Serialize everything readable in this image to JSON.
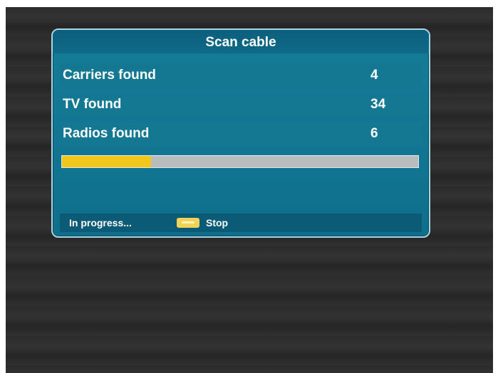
{
  "dialog": {
    "title": "Scan cable",
    "rows": [
      {
        "label": "Carriers found",
        "value": "4"
      },
      {
        "label": "TV found",
        "value": "34"
      },
      {
        "label": "Radios found",
        "value": "6"
      }
    ],
    "progress": {
      "fraction": 0.25,
      "fill_color": "#f0c71a",
      "track_color": "#b9bcbc"
    },
    "footer": {
      "status": "In progress...",
      "stop_key_icon": "yellow-key-icon",
      "stop_label": "Stop"
    }
  },
  "colors": {
    "dialog_background": "#147892",
    "dialog_border": "#a9d6e2",
    "title_background": "#0b5f7d",
    "footer_background": "#0b5a76"
  }
}
